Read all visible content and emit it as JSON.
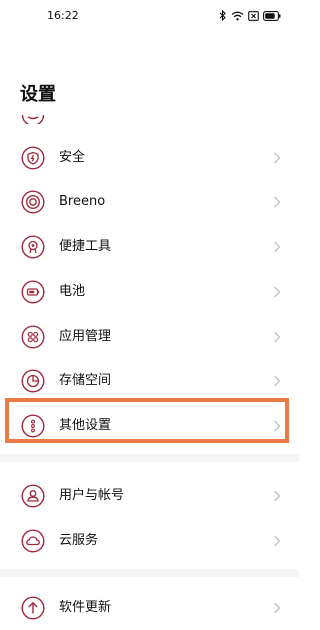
{
  "status_bar": {
    "time": "16:22",
    "icons": [
      "bluetooth-icon",
      "wifi-icon",
      "screen-record-icon",
      "battery-icon"
    ]
  },
  "header": {
    "title": "设置"
  },
  "colors": {
    "icon_accent": "#a3283c",
    "highlight": "#ec7a45",
    "chevron": "#c4c4c4"
  },
  "settings": {
    "items": [
      {
        "label": "安全",
        "icon": "shield-bolt-icon"
      },
      {
        "label": "Breeno",
        "icon": "breeno-ring-icon"
      },
      {
        "label": "便捷工具",
        "icon": "tools-icon"
      },
      {
        "label": "电池",
        "icon": "battery-icon"
      },
      {
        "label": "应用管理",
        "icon": "app-grid-icon"
      },
      {
        "label": "存储空间",
        "icon": "storage-pie-icon"
      },
      {
        "label": "其他设置",
        "icon": "more-dots-icon"
      },
      {
        "label": "用户与帐号",
        "icon": "user-icon"
      },
      {
        "label": "云服务",
        "icon": "cloud-icon"
      },
      {
        "label": "软件更新",
        "icon": "update-arrow-icon"
      }
    ]
  }
}
